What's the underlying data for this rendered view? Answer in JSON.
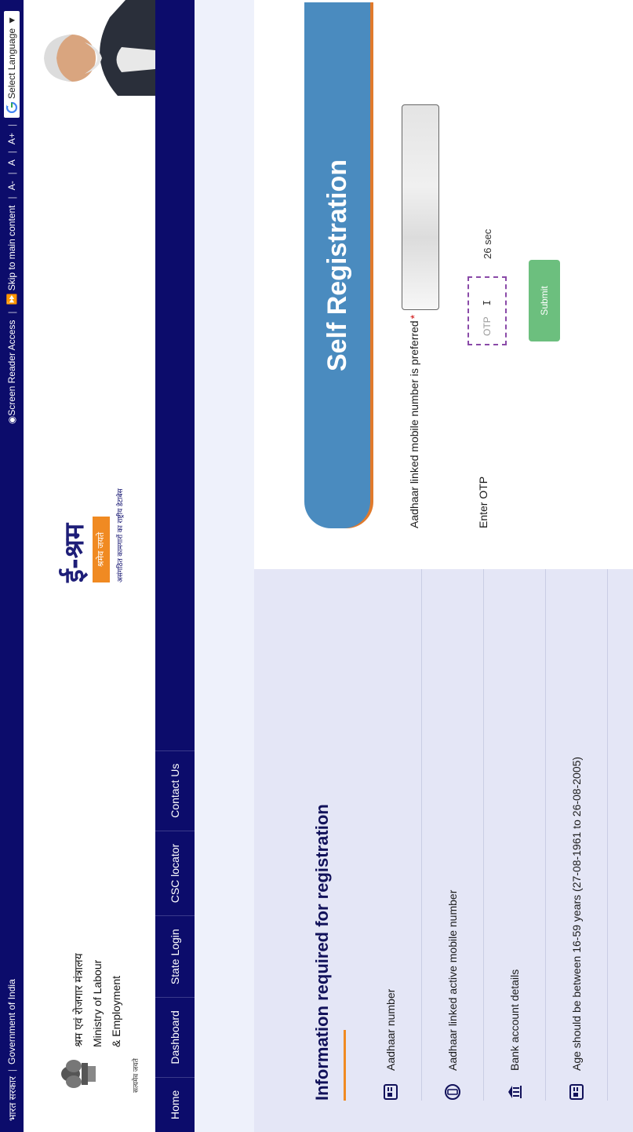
{
  "topbar": {
    "gov_hindi": "भारत सरकार",
    "gov_english": "Government of India",
    "screen_reader": "Screen Reader Access",
    "skip_main": "Skip to main content",
    "font_decrease": "A-",
    "font_normal": "A",
    "font_increase": "A+",
    "language": "Select Language"
  },
  "header": {
    "ministry_hindi": "श्रम एवं रोजगार मंत्रालय",
    "ministry_line1": "Ministry of Labour",
    "ministry_line2": "& Employment",
    "emblem_caption": "सत्यमेव जयते",
    "brand_name": "ई-श्रम",
    "brand_tag": "श्रमेव जयते",
    "brand_sub": "असंगठित कामगारों का राष्ट्रीय डेटाबेस"
  },
  "nav": {
    "items": [
      "Home",
      "Dashboard",
      "State Login",
      "CSC locator",
      "Contact Us"
    ]
  },
  "info": {
    "title": "Information required for registration",
    "items": [
      {
        "label": "Aadhaar number",
        "icon": "id-card-icon"
      },
      {
        "label": "Aadhaar linked active mobile number",
        "icon": "mobile-phone-icon"
      },
      {
        "label": "Bank account details",
        "icon": "bank-icon"
      },
      {
        "label": "Age should be between 16-59 years (27-08-1961 to 26-08-2005)",
        "icon": "id-card-icon"
      }
    ]
  },
  "form": {
    "banner_title": "Self Registration",
    "mobile_label": "Aadhaar linked mobile number is preferred",
    "required_mark": "*",
    "otp_label": "Enter OTP",
    "otp_placeholder": "OTP",
    "timer": "26 sec",
    "submit_label": "Submit"
  },
  "colors": {
    "navy": "#0c0c6b",
    "orange": "#f08a22",
    "banner_blue": "#4a8bbf",
    "submit_green": "#6cbf7e"
  }
}
